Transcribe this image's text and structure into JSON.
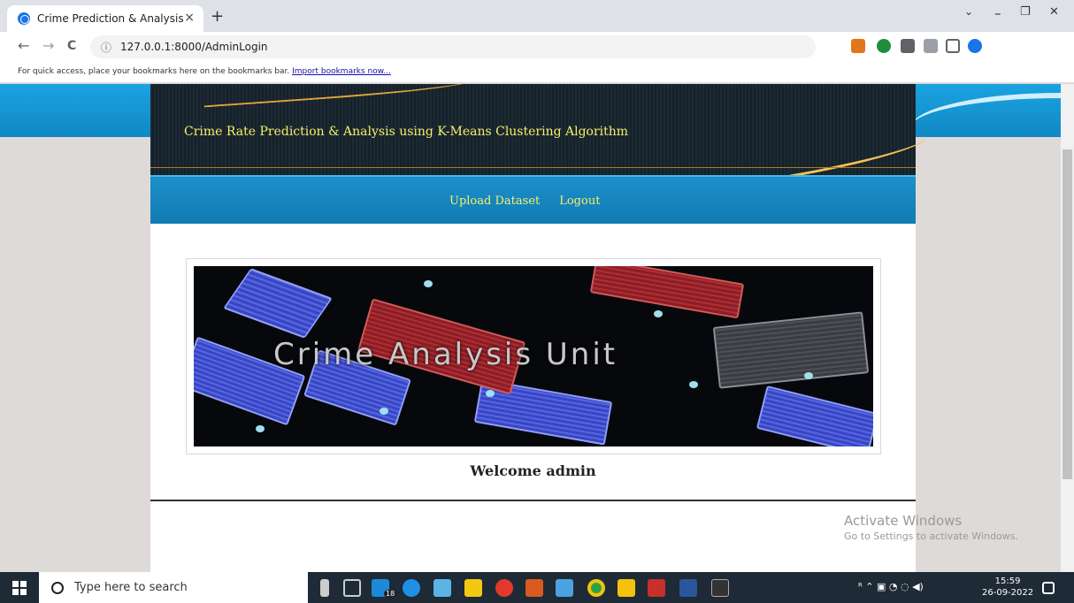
{
  "browser": {
    "tab_title": "Crime Prediction & Analysis",
    "tab_close": "×",
    "new_tab": "+",
    "url": "127.0.0.1:8000/AdminLogin",
    "minimize": "–",
    "maximize": "❐",
    "close": "✕",
    "tab_menu": "⌄",
    "back": "←",
    "forward": "→",
    "reload": "C",
    "info_icon": "ⓘ",
    "bookmarks_text": "For quick access, place your bookmarks here on the bookmarks bar.",
    "bookmarks_link": "Import bookmarks now..."
  },
  "page": {
    "site_title": "Crime Rate Prediction & Analysis using K-Means Clustering Algorithm",
    "nav": {
      "upload": "Upload Dataset",
      "logout": "Logout"
    },
    "hero_text": "Crime Analysis Unit",
    "welcome": "Welcome admin"
  },
  "watermark": {
    "line1": "Activate Windows",
    "line2": "Go to Settings to activate Windows."
  },
  "taskbar": {
    "search_placeholder": "Type here to search",
    "badge": "18",
    "time": "15:59",
    "date": "26-09-2022"
  },
  "colors": {
    "title_yellow": "#f6f06a",
    "nav_blue": "#1b8fca"
  }
}
